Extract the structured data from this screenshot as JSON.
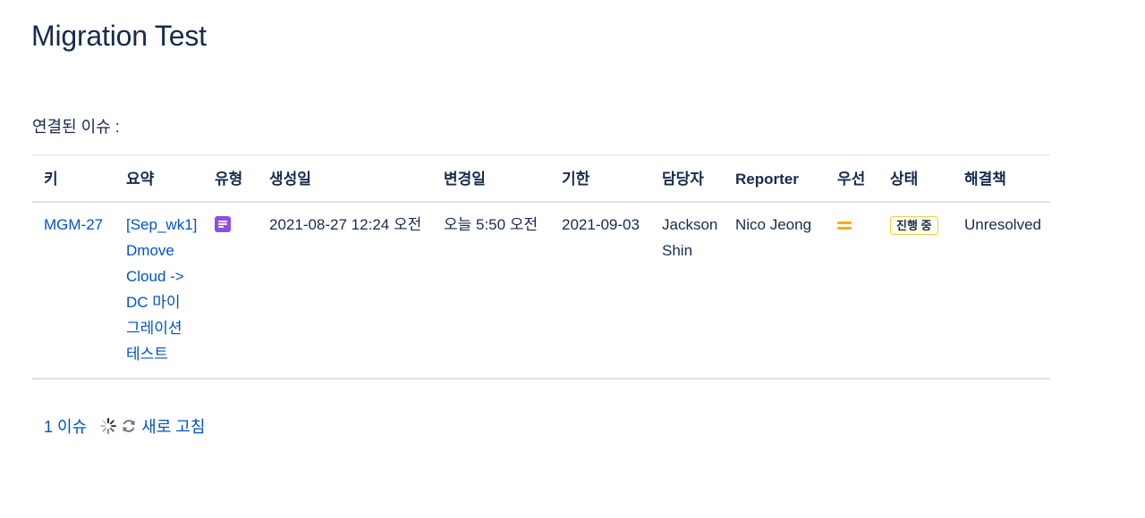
{
  "page": {
    "title": "Migration Test",
    "linked_label": "연결된 이슈 :"
  },
  "table": {
    "headers": [
      {
        "key": "key",
        "label": "키"
      },
      {
        "key": "summary",
        "label": "요약"
      },
      {
        "key": "type",
        "label": "유형"
      },
      {
        "key": "created",
        "label": "생성일"
      },
      {
        "key": "updated",
        "label": "변경일"
      },
      {
        "key": "due",
        "label": "기한"
      },
      {
        "key": "assignee",
        "label": "담당자"
      },
      {
        "key": "reporter",
        "label": "Reporter"
      },
      {
        "key": "priority",
        "label": "우선"
      },
      {
        "key": "status",
        "label": "상태"
      },
      {
        "key": "resolution",
        "label": "해결책"
      }
    ],
    "rows": [
      {
        "key": "MGM-27",
        "summary": "[Sep_wk1] Dmove Cloud -> DC 마이그레이션 테스트",
        "type_icon": "story-icon",
        "created": "2021-08-27 12:24 오전",
        "updated": "오늘 5:50 오전",
        "due": "2021-09-03",
        "assignee": "Jackson Shin",
        "reporter": "Nico Jeong",
        "priority_icon": "priority-medium-icon",
        "status": "진행 중",
        "resolution": "Unresolved"
      }
    ]
  },
  "footer": {
    "count": "1 이슈",
    "refresh_label": "새로 고침"
  },
  "colors": {
    "link": "#0052cc",
    "text": "#172b4d",
    "type_icon": "#904ee2",
    "priority": "#ffab00",
    "status_border": "#f5cd47",
    "divider": "#dfe1e6"
  }
}
